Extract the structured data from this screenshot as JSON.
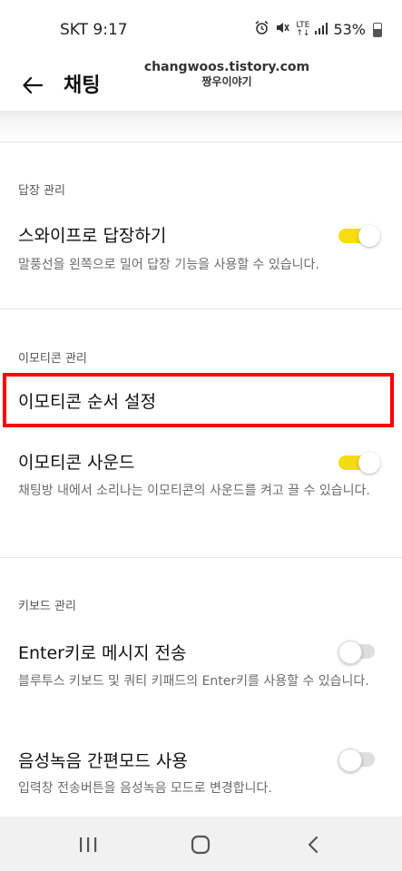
{
  "status_bar": {
    "carrier_time": "SKT 9:17",
    "lte_top": "LTE",
    "lte_bottom": "↑↓",
    "battery": "53%"
  },
  "app_bar": {
    "title": "채팅",
    "watermark_url": "changwoos.tistory.com",
    "watermark_name": "짱우이야기"
  },
  "sections": {
    "reply": {
      "header": "답장 관리",
      "swipe_reply_title": "스와이프로 답장하기",
      "swipe_reply_desc": "말풍선을 왼쪽으로 밀어 답장 기능을 사용할 수 있습니다.",
      "swipe_reply_on": true
    },
    "emoticon": {
      "header": "이모티콘 관리",
      "order_title": "이모티콘 순서 설정",
      "sound_title": "이모티콘 사운드",
      "sound_desc": "채팅방 내에서 소리나는 이모티콘의 사운드를 켜고 끌 수 있습니다.",
      "sound_on": true
    },
    "keyboard": {
      "header": "키보드 관리",
      "enter_title": "Enter키로 메시지 전송",
      "enter_desc": "블루투스 키보드 및 쿼티 키패드의 Enter키를 사용할 수 있습니다.",
      "enter_on": false,
      "voice_title": "음성녹음 간편모드 사용",
      "voice_desc": "입력창 전송버튼을 음성녹음 모드로 변경합니다.",
      "voice_on": false
    }
  },
  "colors": {
    "toggle_on": "#f5dc0f",
    "toggle_off": "#dedede",
    "highlight": "#ff0000"
  }
}
